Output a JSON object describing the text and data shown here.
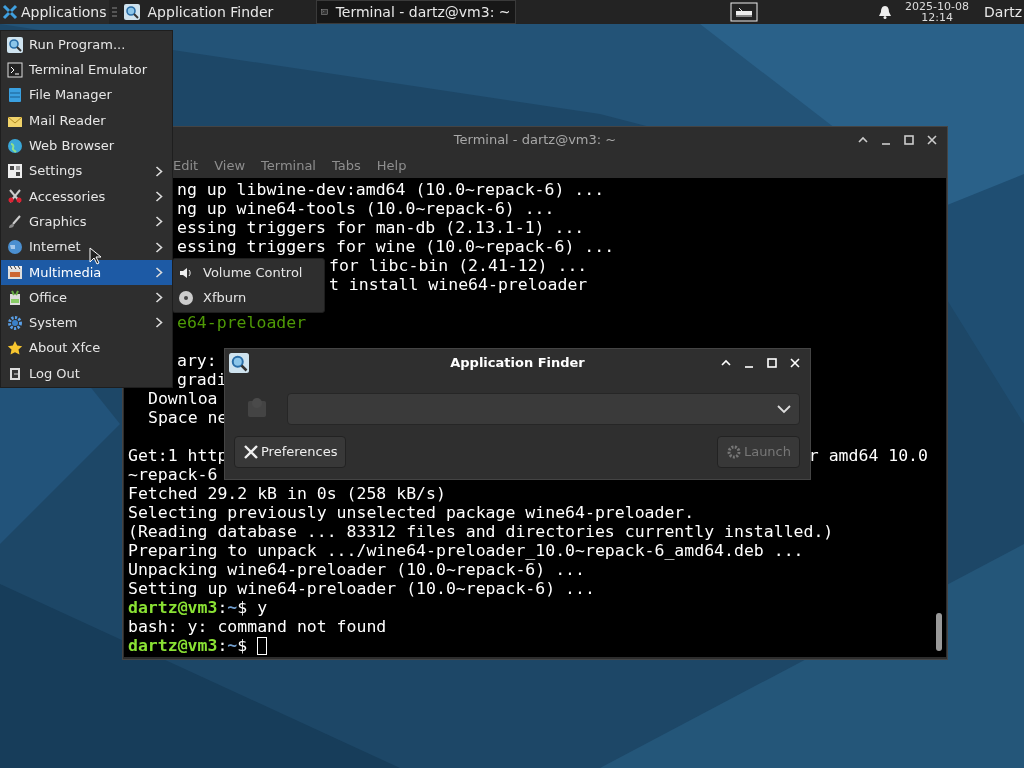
{
  "panel": {
    "apps_button": "Applications",
    "tasks": [
      {
        "label": "Application Finder",
        "selected": false
      },
      {
        "label": "Terminal - dartz@vm3: ~",
        "selected": true
      }
    ],
    "clock": {
      "date": "2025-10-08",
      "time": "12:14"
    },
    "user": "Dartz"
  },
  "terminal": {
    "title": "Terminal - dartz@vm3: ~",
    "focused": false,
    "menu": [
      "Edit",
      "View",
      "Terminal",
      "Tabs",
      "Help"
    ],
    "lines": [
      {
        "kind": "after_menu",
        "text": "ng up libwine-dev:amd64 (10.0~repack-6) ..."
      },
      {
        "kind": "after_menu",
        "text": "ng up wine64-tools (10.0~repack-6) ..."
      },
      {
        "kind": "after_menu",
        "text": "essing triggers for man-db (2.13.1-1) ..."
      },
      {
        "kind": "after_menu",
        "text": "essing triggers for wine (10.0~repack-6) ..."
      },
      {
        "kind": "after_submenu",
        "text": "for libc-bin (2.41-12) ..."
      },
      {
        "kind": "after_submenu",
        "text": "t install wine64-preloader"
      },
      {
        "kind": "blank"
      },
      {
        "kind": "after_menu",
        "text": "e64-preloader",
        "color": "#4e9a06"
      },
      {
        "kind": "blank"
      },
      {
        "kind": "after_menu",
        "text": "ary:"
      },
      {
        "kind": "after_menu",
        "text": "gradi"
      },
      {
        "kind": "indented",
        "text": "Downloa"
      },
      {
        "kind": "indented",
        "text": "Space ne"
      },
      {
        "kind": "blank"
      },
      {
        "kind": "split",
        "text": "Get:1 http",
        "tail": "r amd64 10.0"
      },
      {
        "kind": "plain",
        "text": "~repack-6"
      },
      {
        "kind": "plain",
        "text": "Fetched 29.2 kB in 0s (258 kB/s)"
      },
      {
        "kind": "plain",
        "text": "Selecting previously unselected package wine64-preloader."
      },
      {
        "kind": "plain",
        "text": "(Reading database ... 83312 files and directories currently installed.)"
      },
      {
        "kind": "plain",
        "text": "Preparing to unpack .../wine64-preloader_10.0~repack-6_amd64.deb ..."
      },
      {
        "kind": "plain",
        "text": "Unpacking wine64-preloader (10.0~repack-6) ..."
      },
      {
        "kind": "plain",
        "text": "Setting up wine64-preloader (10.0~repack-6) ..."
      },
      {
        "kind": "prompt",
        "user": "dartz@vm3",
        "sep": ":",
        "path": "~",
        "symbol": "$",
        "command": "y",
        "cursor": false
      },
      {
        "kind": "plain",
        "text": "bash: y: command not found"
      },
      {
        "kind": "prompt",
        "user": "dartz@vm3",
        "sep": ":",
        "path": "~",
        "symbol": "$",
        "cursor": true
      }
    ]
  },
  "finder": {
    "title": "Application Finder",
    "focused": true,
    "buttons": [
      {
        "label": "Preferences",
        "disabled": false
      },
      {
        "label": "Launch",
        "disabled": true
      }
    ]
  },
  "menu": {
    "items": [
      {
        "label": "Run Program...",
        "submenu": false,
        "selected": false
      },
      {
        "label": "Terminal Emulator",
        "submenu": false,
        "selected": false
      },
      {
        "label": "File Manager",
        "submenu": false,
        "selected": false
      },
      {
        "label": "Mail Reader",
        "submenu": false,
        "selected": false
      },
      {
        "label": "Web Browser",
        "submenu": false,
        "selected": false
      },
      {
        "label": "Settings",
        "submenu": true,
        "selected": false
      },
      {
        "label": "Accessories",
        "submenu": true,
        "selected": false
      },
      {
        "label": "Graphics",
        "submenu": true,
        "selected": false
      },
      {
        "label": "Internet",
        "submenu": true,
        "selected": false
      },
      {
        "label": "Multimedia",
        "submenu": true,
        "selected": true
      },
      {
        "label": "Office",
        "submenu": true,
        "selected": false
      },
      {
        "label": "System",
        "submenu": true,
        "selected": false
      },
      {
        "label": "About Xfce",
        "submenu": false,
        "selected": false
      },
      {
        "label": "Log Out",
        "submenu": false,
        "selected": false
      }
    ],
    "submenu": [
      {
        "label": "Volume Control"
      },
      {
        "label": "Xfburn"
      }
    ]
  }
}
